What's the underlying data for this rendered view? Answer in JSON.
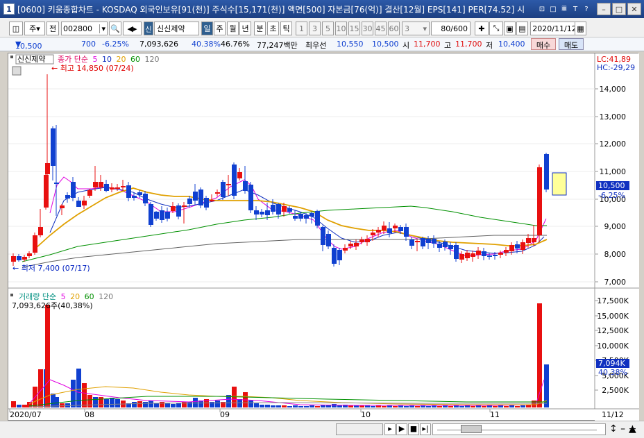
{
  "window": {
    "title": "[0600] 키움종합차트 - KOSDAQ 외국인보유[91(천)] 주식수[15,171(천)] 액면[500] 자본금[76(억)] 결산[12월] EPS[141] PER[74.52] 시",
    "badge": "1"
  },
  "toolbar": {
    "main_label": "주",
    "prev_label": "전",
    "code": "002800",
    "stock_badge": "신",
    "stock_name": "신신제약",
    "period_tabs": [
      "일",
      "주",
      "월",
      "년",
      "분",
      "초",
      "틱"
    ],
    "intervals": [
      "1",
      "3",
      "5",
      "10",
      "15",
      "30",
      "45",
      "60"
    ],
    "custom_interval": "3",
    "count": "80/600",
    "date": "2020/11/12"
  },
  "quote": {
    "price": "10,500",
    "change": "700",
    "change_pct": "-6.25%",
    "volume": "7,093,626",
    "vol_ratio": "40.38%",
    "turnover": "46.76%",
    "amount": "77,247백만",
    "best_label": "최우선",
    "best_bid": "10,550",
    "best_ask": "10,500",
    "open_label": "시",
    "open": "11,700",
    "high_label": "고",
    "high": "11,700",
    "low_label": "저",
    "low": "10,400",
    "buy_label": "매수",
    "sell_label": "매도"
  },
  "price_chart": {
    "stock_label": "신신제약",
    "legend_prefix": "종가 단순",
    "ma_periods": [
      "5",
      "10",
      "20",
      "60",
      "120"
    ],
    "ma_colors": [
      "#e000e0",
      "#1030c0",
      "#e0a000",
      "#009000",
      "#606060"
    ],
    "lc": "LC:41,89",
    "hc": "HC:-29,29",
    "max_label": "최고 14,850 (07/24)",
    "min_label": "최저 7,400 (07/17)",
    "y_ticks": [
      "14,000",
      "13,000",
      "12,000",
      "11,000",
      "10,000",
      "9,000",
      "8,000",
      "7,000"
    ],
    "current_price": "10,500",
    "current_pct": "-6.25%"
  },
  "volume_chart": {
    "legend_prefix": "거래량 단순",
    "ma_periods": [
      "5",
      "20",
      "60",
      "120"
    ],
    "info": "7,093,626주(40,38%)",
    "y_ticks": [
      "17,500K",
      "15,000K",
      "12,500K",
      "10,000K",
      "7,500K",
      "5,000K",
      "2,500K"
    ],
    "current": "7,094K",
    "current_pct": "40,38%"
  },
  "x_axis": [
    "2020/07",
    "08",
    "09",
    "10",
    "11",
    "11/12"
  ],
  "colors": {
    "up": "#e81010",
    "down": "#1040d0",
    "title_bg": "#1c3f82"
  }
}
